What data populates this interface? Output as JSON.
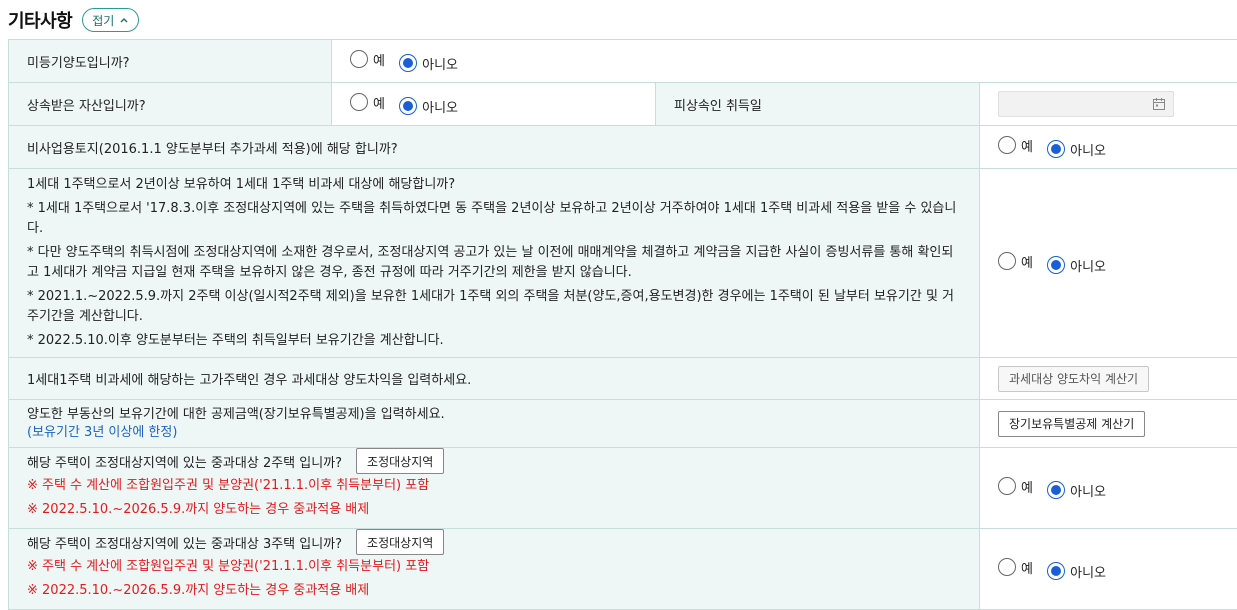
{
  "section": {
    "title": "기타사항",
    "collapse_label": "접기"
  },
  "options": {
    "yes": "예",
    "no": "아니오"
  },
  "rows": [
    {
      "question": "미등기양도입니까?",
      "selected": "no"
    },
    {
      "question": "상속받은 자산입니까?",
      "selected": "no",
      "extra_label": "피상속인 취득일",
      "date_value": ""
    },
    {
      "question": "비사업용토지(2016.1.1 양도분부터 추가과세 적용)에 해당 합니까?",
      "selected": "no"
    },
    {
      "question": "1세대 1주택으로서 2년이상 보유하여 1세대 1주택 비과세 대상에 해당합니까?",
      "notes": [
        "* 1세대 1주택으로서 '17.8.3.이후 조정대상지역에 있는 주택을 취득하였다면 동 주택을 2년이상 보유하고 2년이상 거주하여야 1세대 1주택 비과세 적용을 받을 수 있습니다.",
        "* 다만 양도주택의 취득시점에 조정대상지역에 소재한 경우로서, 조정대상지역 공고가 있는 날 이전에 매매계약을 체결하고 계약금을 지급한 사실이 증빙서류를 통해 확인되고 1세대가 계약금 지급일 현재 주택을 보유하지 않은 경우, 종전 규정에 따라 거주기간의 제한을 받지 않습니다.",
        "* 2021.1.~2022.5.9.까지 2주택 이상(일시적2주택 제외)을 보유한 1세대가 1주택 외의 주택을 처분(양도,증여,용도변경)한 경우에는 1주택이 된 날부터 보유기간 및 거주기간을 계산합니다.",
        "* 2022.5.10.이후 양도분부터는 주택의 취득일부터 보유기간을 계산합니다."
      ],
      "selected": "no"
    },
    {
      "question": "1세대1주택 비과세에 해당하는 고가주택인 경우 과세대상 양도차익을 입력하세요.",
      "button": "과세대상 양도차익 계산기"
    },
    {
      "question": "양도한 부동산의 보유기간에 대한 공제금액(장기보유특별공제)을 입력하세요.",
      "hint": "(보유기간 3년 이상에 한정)",
      "button": "장기보유특별공제 계산기"
    },
    {
      "question": "해당 주택이 조정대상지역에 있는 중과대상 2주택 입니까?",
      "button": "조정대상지역",
      "warnings": [
        "※ 주택 수 계산에 조합원입주권 및 분양권('21.1.1.이후 취득분부터) 포함",
        "※ 2022.5.10.~2026.5.9.까지 양도하는 경우 중과적용 배제"
      ],
      "selected": "no"
    },
    {
      "question": "해당 주택이 조정대상지역에 있는 중과대상 3주택 입니까?",
      "button": "조정대상지역",
      "warnings": [
        "※ 주택 수 계산에 조합원입주권 및 분양권('21.1.1.이후 취득분부터) 포함",
        "※ 2022.5.10.~2026.5.9.까지 양도하는 경우 중과적용 배제"
      ],
      "selected": "no"
    }
  ],
  "colors": {
    "label_bg": "#eef7f6",
    "border": "#c7dedb",
    "accent": "#1a5fd6",
    "warning": "#e21b1b",
    "hint": "#1a64c8"
  }
}
